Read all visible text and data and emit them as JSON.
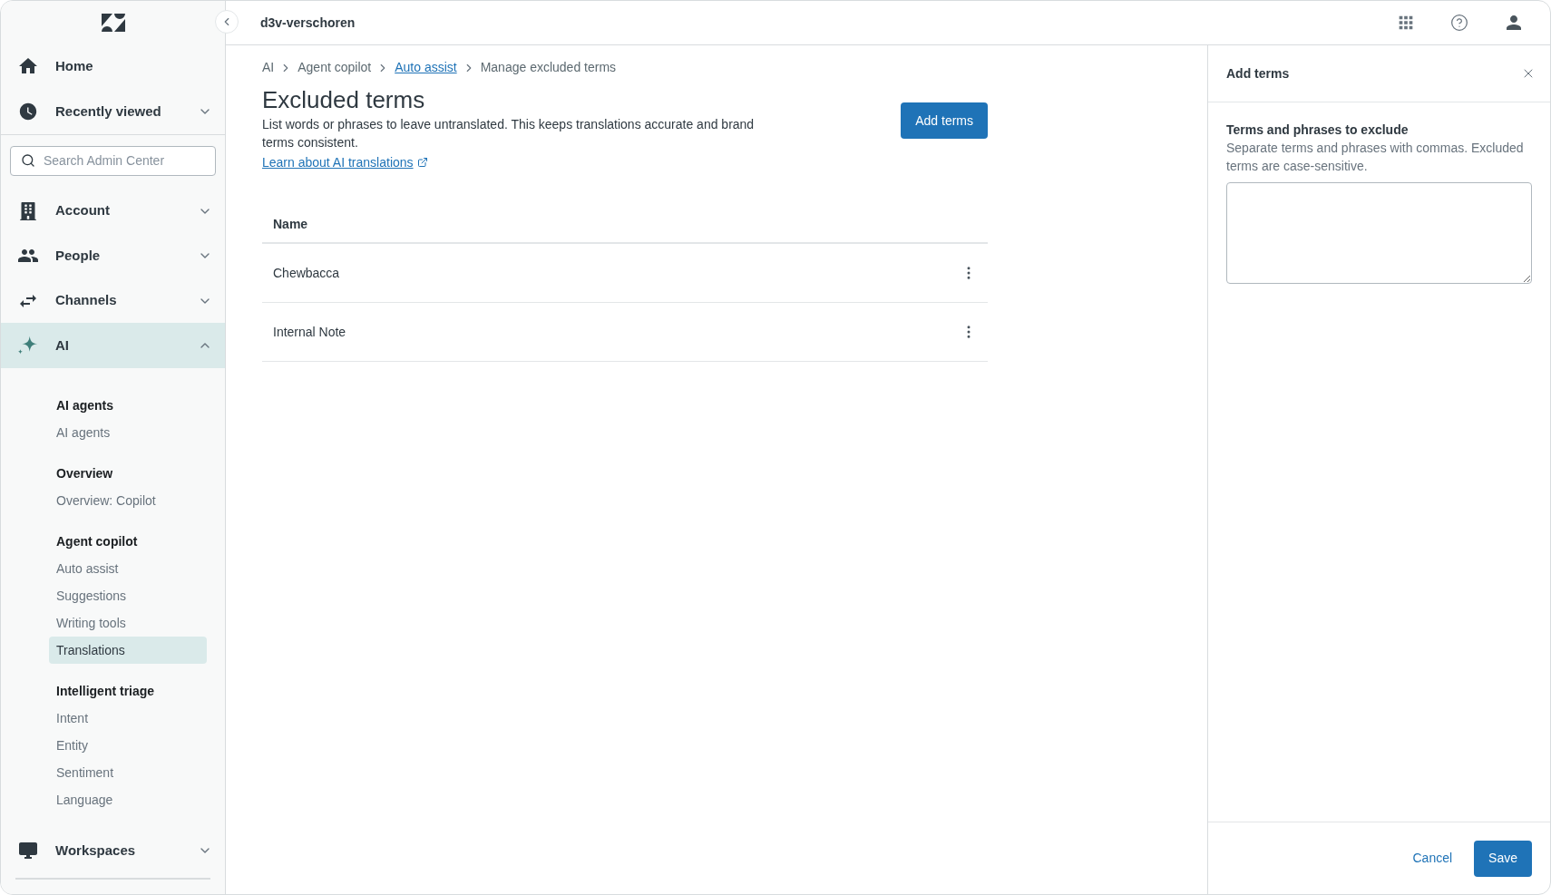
{
  "sidebar": {
    "nav": [
      {
        "label": "Home",
        "kind": "link",
        "selected": false
      },
      {
        "label": "Recently viewed",
        "kind": "group",
        "selected": false,
        "expanded": false
      }
    ],
    "search": {
      "placeholder": "Search Admin Center"
    },
    "groups": [
      {
        "label": "Account",
        "selected": false,
        "expanded": false
      },
      {
        "label": "People",
        "selected": false,
        "expanded": false
      },
      {
        "label": "Channels",
        "selected": false,
        "expanded": false
      },
      {
        "label": "AI",
        "selected": true,
        "expanded": true
      }
    ],
    "sections": [
      {
        "heading": "AI agents",
        "items": [
          {
            "label": "AI agents",
            "selected": false
          }
        ]
      },
      {
        "heading": "Overview",
        "items": [
          {
            "label": "Overview: Copilot",
            "selected": false
          }
        ]
      },
      {
        "heading": "Agent copilot",
        "items": [
          {
            "label": "Auto assist",
            "selected": false
          },
          {
            "label": "Suggestions",
            "selected": false
          },
          {
            "label": "Writing tools",
            "selected": false
          },
          {
            "label": "Translations",
            "selected": true
          }
        ]
      },
      {
        "heading": "Intelligent triage",
        "items": [
          {
            "label": "Intent",
            "selected": false
          },
          {
            "label": "Entity",
            "selected": false
          },
          {
            "label": "Sentiment",
            "selected": false
          },
          {
            "label": "Language",
            "selected": false
          }
        ]
      }
    ],
    "bottom": {
      "label": "Workspaces",
      "selected": false,
      "expanded": false
    }
  },
  "header": {
    "account": "d3v-verschoren"
  },
  "breadcrumb": [
    {
      "label": "AI",
      "link": false
    },
    {
      "label": "Agent copilot",
      "link": false
    },
    {
      "label": "Auto assist",
      "link": true
    },
    {
      "label": "Manage excluded terms",
      "link": false
    }
  ],
  "page": {
    "title": "Excluded terms",
    "description": "List words or phrases to leave untranslated. This keeps translations accurate and brand terms consistent.",
    "link": "Learn about AI translations",
    "button": "Add terms"
  },
  "table": {
    "columns": [
      "Name"
    ],
    "rows": [
      {
        "name": "Chewbacca"
      },
      {
        "name": "Internal Note"
      }
    ]
  },
  "panel": {
    "title": "Add terms",
    "label": "Terms and phrases to exclude",
    "hint": "Separate terms and phrases with commas. Excluded terms are case-sensitive.",
    "cancel": "Cancel",
    "save": "Save"
  }
}
